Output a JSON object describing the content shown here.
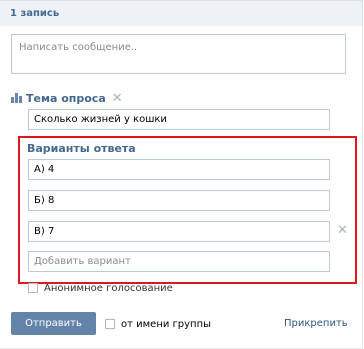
{
  "header": {
    "record_count": "1 запись"
  },
  "composer": {
    "placeholder": "Написать сообщение.."
  },
  "poll": {
    "title": "Тема опроса",
    "topic_value": "Сколько жизней у кошки",
    "answers_title": "Варианты ответа",
    "answers": [
      "А) 4",
      "Б) 8",
      "В) 7"
    ],
    "add_placeholder": "Добавить вариант",
    "anonymous_label": "Анонимное голосование"
  },
  "footer": {
    "send_label": "Отправить",
    "group_label": "от имени группы",
    "pin_label": "Прикрепить"
  },
  "colors": {
    "accent": "#45688e",
    "button": "#6383a8",
    "highlight_frame": "#e3161b"
  },
  "icons": [
    "poll-chart-icon",
    "remove-x-icon"
  ]
}
